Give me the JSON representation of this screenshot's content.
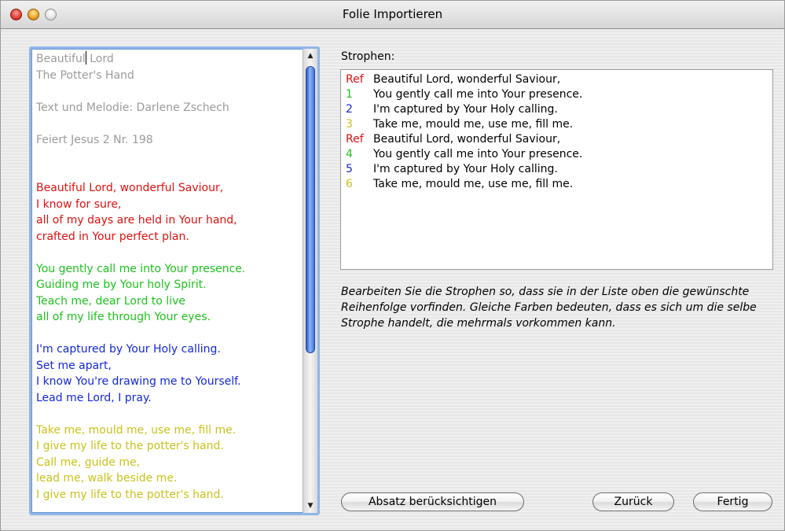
{
  "window": {
    "title": "Folie Importieren"
  },
  "lyrics": {
    "lines": [
      {
        "text": "Beautiful Lord",
        "color": "#9b9b9b"
      },
      {
        "text": "The Potter's Hand",
        "color": "#9b9b9b"
      },
      {
        "text": "",
        "color": "#9b9b9b"
      },
      {
        "text": "Text und Melodie: Darlene Zschech",
        "color": "#9b9b9b"
      },
      {
        "text": "",
        "color": "#9b9b9b"
      },
      {
        "text": "Feiert Jesus 2 Nr. 198",
        "color": "#9b9b9b"
      },
      {
        "text": "",
        "color": "#9b9b9b"
      },
      {
        "text": "",
        "color": "#9b9b9b"
      },
      {
        "text": "Beautiful Lord, wonderful Saviour,",
        "color": "#e01010"
      },
      {
        "text": "I know for sure,",
        "color": "#e01010"
      },
      {
        "text": "all of my days are held in Your hand,",
        "color": "#e01010"
      },
      {
        "text": "crafted in Your perfect plan.",
        "color": "#e01010"
      },
      {
        "text": "",
        "color": "#e01010"
      },
      {
        "text": "You gently call me into Your presence.",
        "color": "#1dc21d"
      },
      {
        "text": "Guiding me by Your holy Spirit.",
        "color": "#1dc21d"
      },
      {
        "text": "Teach me, dear Lord to live",
        "color": "#1dc21d"
      },
      {
        "text": "all of my life through Your eyes.",
        "color": "#1dc21d"
      },
      {
        "text": "",
        "color": "#1dc21d"
      },
      {
        "text": "I'm captured by Your Holy calling.",
        "color": "#1428d6"
      },
      {
        "text": "Set me apart,",
        "color": "#1428d6"
      },
      {
        "text": "I know You're drawing me to Yourself.",
        "color": "#1428d6"
      },
      {
        "text": "Lead me Lord, I pray.",
        "color": "#1428d6"
      },
      {
        "text": "",
        "color": "#1428d6"
      },
      {
        "text": "Take me, mould me, use me, fill me.",
        "color": "#c9c21a"
      },
      {
        "text": "I give my life to the potter's hand.",
        "color": "#c9c21a"
      },
      {
        "text": "Call me, guide me,",
        "color": "#c9c21a"
      },
      {
        "text": "lead me, walk beside me.",
        "color": "#c9c21a"
      },
      {
        "text": "I give my life to the potter's hand.",
        "color": "#c9c21a"
      }
    ]
  },
  "strophen": {
    "label": "Strophen:",
    "items": [
      {
        "tag": "Ref",
        "tag_color": "#e01010",
        "text": "Beautiful Lord, wonderful Saviour,"
      },
      {
        "tag": "1",
        "tag_color": "#1dc21d",
        "text": "You gently call me into Your presence."
      },
      {
        "tag": "2",
        "tag_color": "#1428d6",
        "text": "I'm captured by Your Holy calling."
      },
      {
        "tag": "3",
        "tag_color": "#c9c21a",
        "text": "Take me, mould me, use me, fill me."
      },
      {
        "tag": "Ref",
        "tag_color": "#e01010",
        "text": "Beautiful Lord, wonderful Saviour,"
      },
      {
        "tag": "4",
        "tag_color": "#1dc21d",
        "text": "You gently call me into Your presence."
      },
      {
        "tag": "5",
        "tag_color": "#1428d6",
        "text": "I'm captured by Your Holy calling."
      },
      {
        "tag": "6",
        "tag_color": "#c9c21a",
        "text": "Take me, mould me, use me, fill me."
      }
    ]
  },
  "hint": "Bearbeiten Sie die Strophen so, dass sie in der Liste oben die gewünschte Reihenfolge vorfinden. Gleiche Farben bedeuten, dass es sich um die selbe Strophe handelt, die mehrmals vorkommen kann.",
  "buttons": {
    "absatz": "Absatz berücksichtigen",
    "zurueck": "Zurück",
    "fertig": "Fertig"
  },
  "icons": {
    "close": "close-button-icon",
    "minimize": "minimize-button-icon",
    "zoom": "zoom-button-icon",
    "scroll_up": "up-arrow-icon",
    "scroll_down": "down-arrow-icon"
  }
}
